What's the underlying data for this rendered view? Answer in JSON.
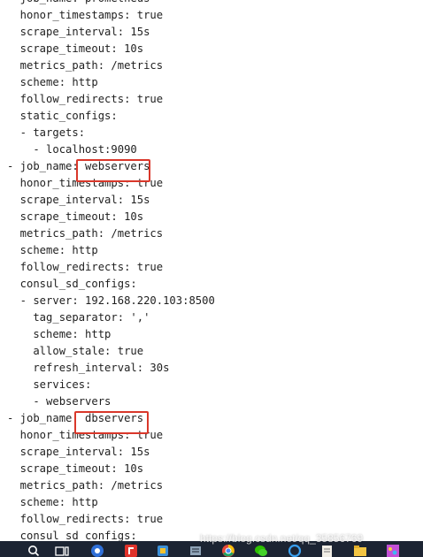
{
  "editor": {
    "lines": [
      "- job_name: prometheus",
      "  honor_timestamps: true",
      "  scrape_interval: 15s",
      "  scrape_timeout: 10s",
      "  metrics_path: /metrics",
      "  scheme: http",
      "  follow_redirects: true",
      "  static_configs:",
      "  - targets:",
      "    - localhost:9090",
      "- job_name: webservers",
      "  honor_timestamps: true",
      "  scrape_interval: 15s",
      "  scrape_timeout: 10s",
      "  metrics_path: /metrics",
      "  scheme: http",
      "  follow_redirects: true",
      "  consul_sd_configs:",
      "  - server: 192.168.220.103:8500",
      "    tag_separator: ','",
      "    scheme: http",
      "    allow_stale: true",
      "    refresh_interval: 30s",
      "    services:",
      "    - webservers",
      "- job_name: dbservers",
      "  honor_timestamps: true",
      "  scrape_interval: 15s",
      "  scrape_timeout: 10s",
      "  metrics_path: /metrics",
      "  scheme: http",
      "  follow_redirects: true",
      "  consul_sd_configs:"
    ],
    "highlight_color": "#d9372a"
  },
  "watermark": {
    "text": "https://blog.csdn.net/qq_35856769"
  },
  "taskbar": {
    "icons": [
      "search-icon",
      "task-view-icon",
      "chrome-icon",
      "foxit-icon",
      "app-icon",
      "notes-icon",
      "chrome-icon",
      "wechat-icon",
      "circle-app-icon",
      "notepad-icon",
      "folder-icon",
      "paint-icon"
    ],
    "background": "#1c2433"
  }
}
